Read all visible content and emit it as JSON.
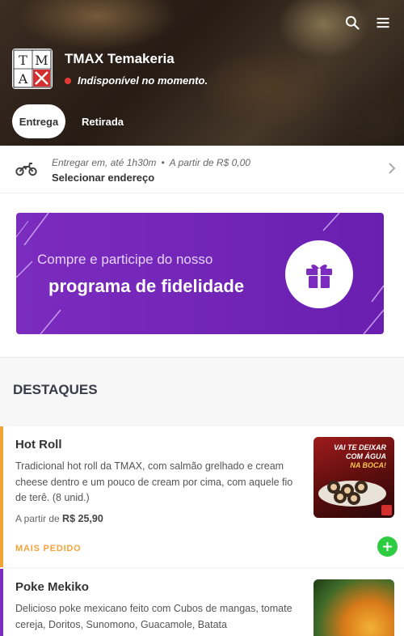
{
  "header": {
    "store_name": "TMAX Temakeria",
    "status_text": "Indisponível no momento.",
    "status_color": "#e53935",
    "logo_letters": [
      "T",
      "M",
      "A",
      "X"
    ],
    "icons": [
      "search-icon",
      "menu-icon"
    ]
  },
  "tabs": [
    {
      "label": "Entrega",
      "active": true
    },
    {
      "label": "Retirada",
      "active": false
    }
  ],
  "delivery": {
    "icon": "motorcycle-icon",
    "label_prefix": "Entregar em,",
    "time": "até 1h30m",
    "separator": "•",
    "min_price": "A partir de R$ 0,00",
    "address_cta": "Selecionar endereço"
  },
  "banner": {
    "line1": "Compre e participe do nosso",
    "line2": "programa de fidelidade",
    "icon": "gift-icon",
    "color": "#7b2cbf"
  },
  "section": {
    "title": "DESTAQUES"
  },
  "products": [
    {
      "name": "Hot Roll",
      "description": "Tradicional hot roll da TMAX, com salmão grelhado e cream cheese dentro e um pouco de cream por cima, com aquele fio de terê. (8 unid.)",
      "price_prefix": "A partir de",
      "price": "R$ 25,90",
      "badge": "MAIS PEDIDO",
      "image_caption_1": "VAI TE DEIXAR",
      "image_caption_2": "COM ÁGUA",
      "image_caption_3": "NA BOCA!",
      "accent": "#f4a338"
    },
    {
      "name": "Poke Mekiko",
      "description": "Delicioso poke mexicano feito com Cubos de mangas, tomate cereja, Doritos, Sunomono, Guacamole, Batata",
      "accent": "#7b2cbf"
    }
  ],
  "add_button_color": "#2ecc40"
}
